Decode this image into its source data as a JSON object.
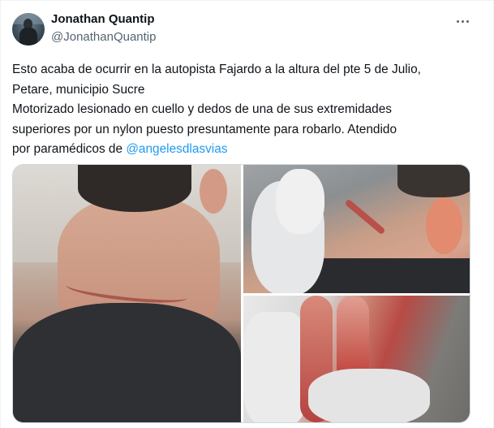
{
  "author": {
    "display_name": "Jonathan Quantip",
    "handle": "@JonathanQuantip"
  },
  "tweet": {
    "lines": [
      "Esto acaba de ocurrir en la autopista Fajardo a la altura del pte 5 de Julio,",
      "Petare, municipio Sucre",
      "Motorizado lesionado en cuello y dedos de una de sus extremidades",
      "superiores por un nylon puesto presuntamente para robarlo. Atendido"
    ],
    "last_line_prefix": "por paramédicos de ",
    "mention": "@angelesdlasvias"
  },
  "icons": {
    "more": "more-horizontal-icon"
  },
  "colors": {
    "link": "#1d9bf0",
    "secondary_text": "#536471",
    "primary_text": "#0f1419"
  }
}
